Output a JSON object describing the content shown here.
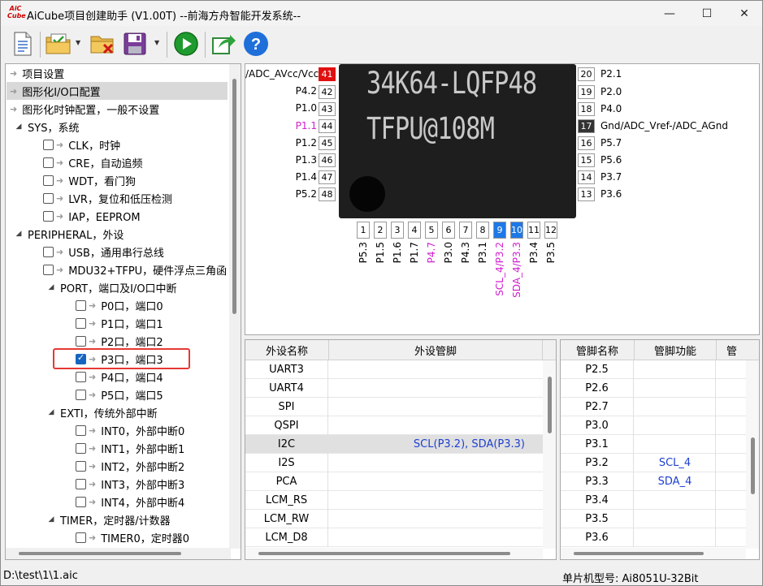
{
  "window": {
    "title": "AiCube项目创建助手 (V1.00T) --前海方舟智能开发系统--",
    "logo_top": "AiC",
    "logo_bottom": "Cube",
    "controls": {
      "minimize": "—",
      "maximize": "☐",
      "close": "✕"
    }
  },
  "toolbar": {
    "icons": [
      "new-file-icon",
      "open-project-icon",
      "delete-project-icon",
      "save-icon",
      "run-icon",
      "export-icon",
      "help-icon"
    ],
    "help_label": "?"
  },
  "tree": {
    "items": [
      {
        "label": "项目设置"
      },
      {
        "label": "图形化I/O口配置"
      },
      {
        "label": "图形化时钟配置，一般不设置"
      },
      {
        "label": "SYS，系统"
      },
      {
        "label": "CLK，时钟"
      },
      {
        "label": "CRE，自动追频"
      },
      {
        "label": "WDT，看门狗"
      },
      {
        "label": "LVR，复位和低压检测"
      },
      {
        "label": "IAP，EEPROM"
      },
      {
        "label": "PERIPHERAL，外设"
      },
      {
        "label": "USB，通用串行总线"
      },
      {
        "label": "MDU32+TFPU，硬件浮点三角函"
      },
      {
        "label": "PORT，端口及I/O口中断"
      },
      {
        "label": "P0口，端口0"
      },
      {
        "label": "P1口，端口1"
      },
      {
        "label": "P2口，端口2"
      },
      {
        "label": "P3口，端口3"
      },
      {
        "label": "P4口，端口4"
      },
      {
        "label": "P5口，端口5"
      },
      {
        "label": "EXTI，传统外部中断"
      },
      {
        "label": "INT0，外部中断0"
      },
      {
        "label": "INT1，外部中断1"
      },
      {
        "label": "INT2，外部中断2"
      },
      {
        "label": "INT3，外部中断3"
      },
      {
        "label": "INT4，外部中断4"
      },
      {
        "label": "TIMER，定时器/计数器"
      },
      {
        "label": "TIMER0，定时器0"
      }
    ]
  },
  "chip": {
    "line1": "34K64-LQFP48",
    "line2": "TFPU@108M",
    "left_pins": [
      {
        "num": "41",
        "label": "/ADC_AVcc/Vcc"
      },
      {
        "num": "42",
        "label": "P4.2"
      },
      {
        "num": "43",
        "label": "P1.0"
      },
      {
        "num": "44",
        "label": "P1.1"
      },
      {
        "num": "45",
        "label": "P1.2"
      },
      {
        "num": "46",
        "label": "P1.3"
      },
      {
        "num": "47",
        "label": "P1.4"
      },
      {
        "num": "48",
        "label": "P5.2"
      }
    ],
    "right_pins": [
      {
        "num": "20",
        "label": "P2.1"
      },
      {
        "num": "19",
        "label": "P2.0"
      },
      {
        "num": "18",
        "label": "P4.0"
      },
      {
        "num": "17",
        "label": "Gnd/ADC_Vref-/ADC_AGnd"
      },
      {
        "num": "16",
        "label": "P5.7"
      },
      {
        "num": "15",
        "label": "P5.6"
      },
      {
        "num": "14",
        "label": "P3.7"
      },
      {
        "num": "13",
        "label": "P3.6"
      }
    ],
    "bottom_pins": [
      {
        "num": "1",
        "label": "P5.3"
      },
      {
        "num": "2",
        "label": "P1.5"
      },
      {
        "num": "3",
        "label": "P1.6"
      },
      {
        "num": "4",
        "label": "P1.7"
      },
      {
        "num": "5",
        "label": "P4.7"
      },
      {
        "num": "6",
        "label": "P3.0"
      },
      {
        "num": "7",
        "label": "P4.3"
      },
      {
        "num": "8",
        "label": "P3.1"
      },
      {
        "num": "9",
        "label": "SCL_4/P3.2"
      },
      {
        "num": "10",
        "label": "SDA_4/P3.3"
      },
      {
        "num": "11",
        "label": "P3.4"
      },
      {
        "num": "12",
        "label": "P3.5"
      }
    ],
    "colors": {
      "power": "#e01010",
      "ground": "#333333",
      "assigned": "#1e78e6",
      "special_label": "#d020d0",
      "pin_label": "#000000"
    }
  },
  "periph_table": {
    "headers": [
      "外设名称",
      "外设管脚"
    ],
    "rows": [
      {
        "name": "UART3",
        "pins": ""
      },
      {
        "name": "UART4",
        "pins": ""
      },
      {
        "name": "SPI",
        "pins": ""
      },
      {
        "name": "QSPI",
        "pins": ""
      },
      {
        "name": "I2C",
        "pins": "SCL(P3.2), SDA(P3.3)"
      },
      {
        "name": "I2S",
        "pins": ""
      },
      {
        "name": "PCA",
        "pins": ""
      },
      {
        "name": "LCM_RS",
        "pins": ""
      },
      {
        "name": "LCM_RW",
        "pins": ""
      },
      {
        "name": "LCM_D8",
        "pins": ""
      }
    ]
  },
  "pin_table": {
    "headers": [
      "管脚名称",
      "管脚功能",
      "管"
    ],
    "rows": [
      {
        "pin": "P2.5",
        "func": ""
      },
      {
        "pin": "P2.6",
        "func": ""
      },
      {
        "pin": "P2.7",
        "func": ""
      },
      {
        "pin": "P3.0",
        "func": ""
      },
      {
        "pin": "P3.1",
        "func": ""
      },
      {
        "pin": "P3.2",
        "func": "SCL_4"
      },
      {
        "pin": "P3.3",
        "func": "SDA_4"
      },
      {
        "pin": "P3.4",
        "func": ""
      },
      {
        "pin": "P3.5",
        "func": ""
      },
      {
        "pin": "P3.6",
        "func": ""
      }
    ]
  },
  "status": {
    "path": "D:\\test\\1\\1.aic",
    "mcu": "单片机型号:  Ai8051U-32Bit"
  }
}
